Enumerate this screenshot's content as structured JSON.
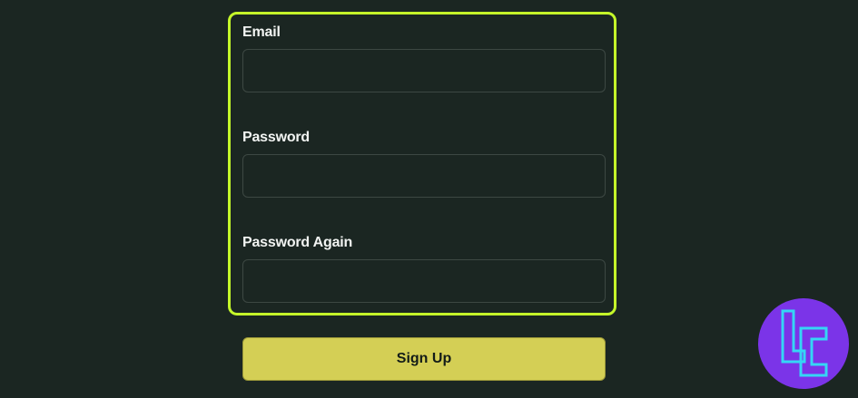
{
  "form": {
    "email": {
      "label": "Email",
      "value": "",
      "placeholder": ""
    },
    "password": {
      "label": "Password",
      "value": "",
      "placeholder": ""
    },
    "password_again": {
      "label": "Password Again",
      "value": "",
      "placeholder": ""
    },
    "submit_label": "Sign Up"
  },
  "colors": {
    "background": "#1b2622",
    "highlight_border": "#c5f82a",
    "input_border": "#3d4843",
    "button": "#d4cf55",
    "button_text": "#131c18",
    "label_text": "#f2f4f2",
    "logo_circle": "#7b34e8",
    "logo_mark": "#35d6f5"
  },
  "icons": {
    "logo": "tc-monogram-logo"
  }
}
